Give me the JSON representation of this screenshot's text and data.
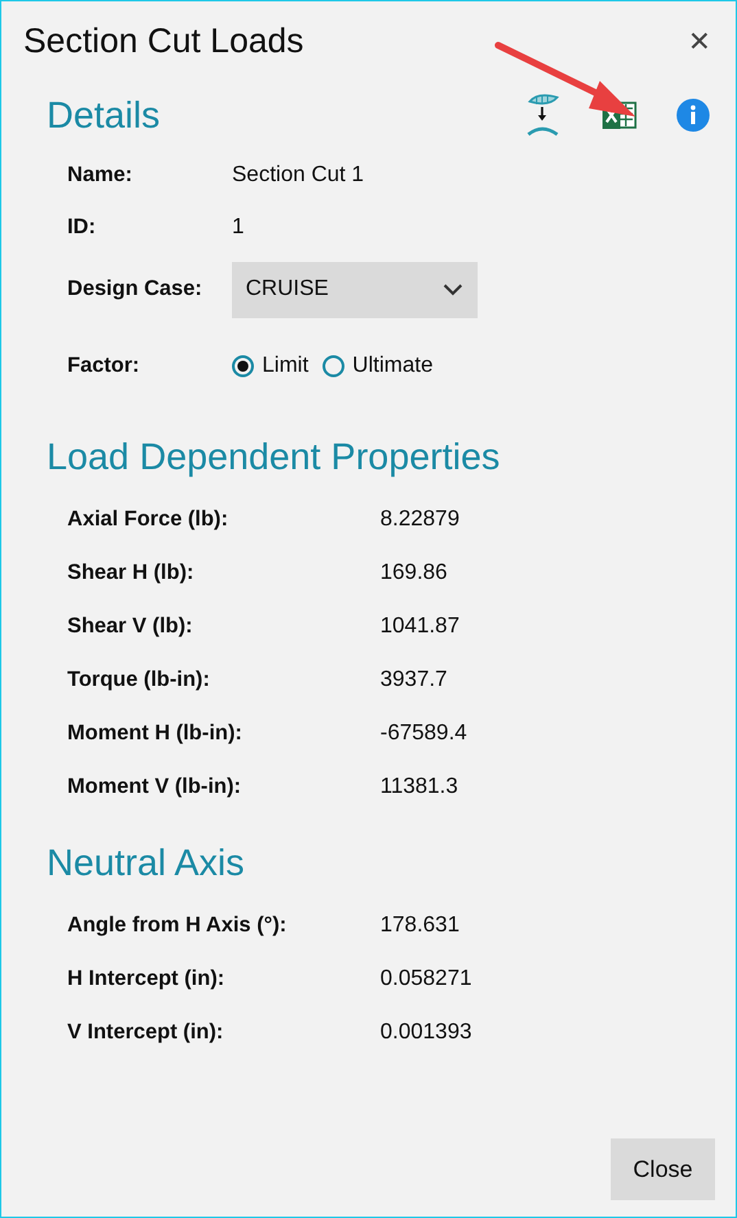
{
  "window": {
    "title": "Section Cut Loads",
    "close": "✕"
  },
  "details": {
    "heading": "Details",
    "fields": [
      {
        "kind": "text",
        "label": "Name:",
        "value": "Section Cut 1"
      },
      {
        "kind": "text",
        "label": "ID:",
        "value": "1"
      },
      {
        "kind": "dropdown",
        "label": "Design Case:",
        "value": "CRUISE"
      },
      {
        "kind": "radio",
        "label": "Factor:",
        "options": [
          {
            "label": "Limit",
            "selected": true
          },
          {
            "label": "Ultimate",
            "selected": false
          }
        ]
      }
    ]
  },
  "sections": [
    {
      "heading": "Load Dependent Properties",
      "rows": [
        {
          "label": "Axial Force (lb):",
          "value": "8.22879"
        },
        {
          "label": "Shear H (lb):",
          "value": "169.86"
        },
        {
          "label": "Shear V (lb):",
          "value": "1041.87"
        },
        {
          "label": "Torque (lb-in):",
          "value": "3937.7"
        },
        {
          "label": "Moment H (lb-in):",
          "value": "-67589.4"
        },
        {
          "label": "Moment V (lb-in):",
          "value": "11381.3"
        }
      ]
    },
    {
      "heading": "Neutral Axis",
      "rows": [
        {
          "label": "Angle from H Axis (°):",
          "value": "178.631"
        },
        {
          "label": "H Intercept (in):",
          "value": "0.058271"
        },
        {
          "label": "V Intercept (in):",
          "value": "0.001393"
        }
      ]
    }
  ],
  "buttons": [
    "Close"
  ]
}
